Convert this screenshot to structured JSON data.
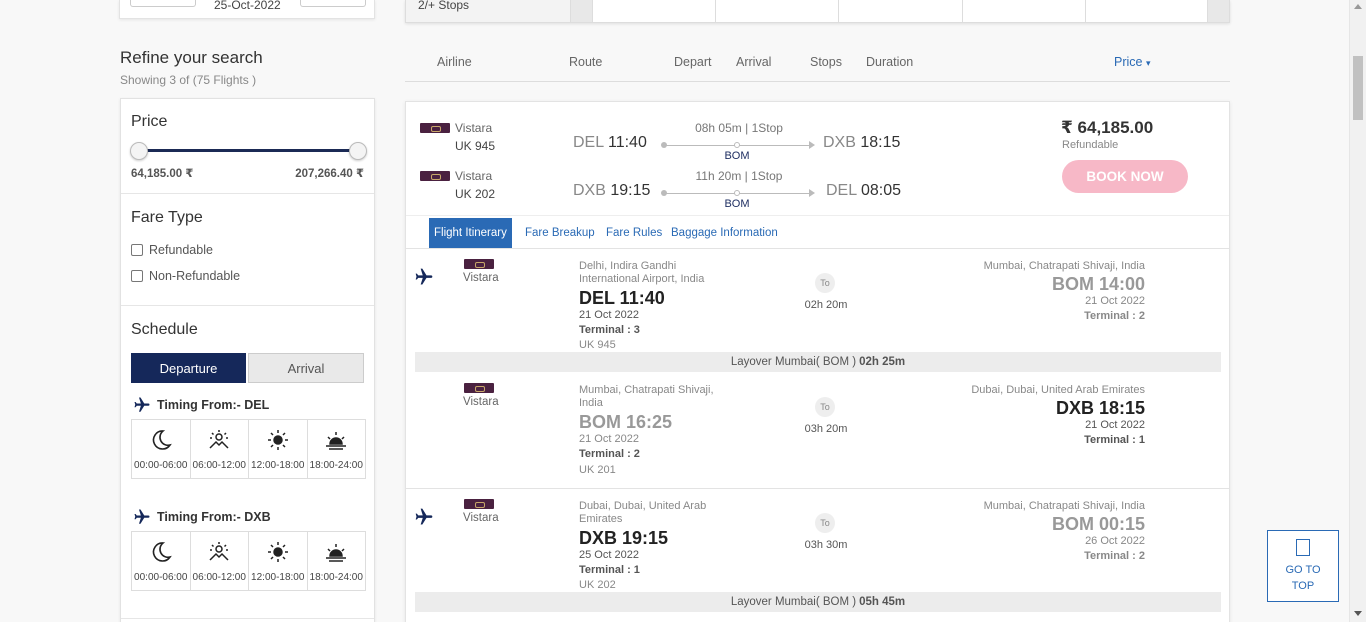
{
  "search_top": {
    "date": "25-Oct-2022",
    "stops_label": "2/+ Stops"
  },
  "refine": {
    "title": "Refine your search",
    "showing": "Showing 3 of (75 Flights )"
  },
  "filters": {
    "price": {
      "title": "Price",
      "min": "64,185.00 ₹",
      "max": "207,266.40 ₹"
    },
    "fare_type": {
      "title": "Fare Type",
      "options": [
        "Refundable",
        "Non-Refundable"
      ]
    },
    "schedule": {
      "title": "Schedule",
      "tabs": [
        "Departure",
        "Arrival"
      ],
      "active_tab": "Departure",
      "groups": [
        {
          "label": "Timing From:- DEL"
        },
        {
          "label": "Timing From:- DXB"
        }
      ],
      "slots": [
        "00:00-06:00",
        "06:00-12:00",
        "12:00-18:00",
        "18:00-24:00"
      ]
    }
  },
  "results_header": {
    "airline": "Airline",
    "route": "Route",
    "depart": "Depart",
    "arrival": "Arrival",
    "stops": "Stops",
    "duration": "Duration",
    "price": "Price"
  },
  "flight_card": {
    "outbound": {
      "airline": "Vistara",
      "code": "UK  945",
      "from_code": "DEL",
      "from_time": "11:40",
      "duration": "08h 05m | 1Stop",
      "via": "BOM",
      "to_code": "DXB",
      "to_time": "18:15"
    },
    "inbound": {
      "airline": "Vistara",
      "code": "UK  202",
      "from_code": "DXB",
      "from_time": "19:15",
      "duration": "11h 20m | 1Stop",
      "via": "BOM",
      "to_code": "DEL",
      "to_time": "08:05"
    },
    "price": "₹ 64,185.00",
    "refundable": "Refundable",
    "book": "BOOK NOW",
    "tabs": [
      "Flight Itinerary",
      "Fare Breakup",
      "Fare Rules",
      "Baggage Information"
    ],
    "itinerary": [
      {
        "airline": "Vistara",
        "from_place": "Delhi, Indira Gandhi International Airport, India",
        "from_big": "DEL 11:40",
        "from_date": "21 Oct 2022",
        "from_terminal": "Terminal : 3",
        "flight_no": "UK 945",
        "to_badge": "To",
        "duration": "02h 20m",
        "to_place": "Mumbai, Chatrapati Shivaji, India",
        "to_big": "BOM 14:00",
        "to_date": "21 Oct 2022",
        "to_terminal": "Terminal : 2"
      },
      {
        "airline": "Vistara",
        "from_place": "Mumbai, Chatrapati Shivaji, India",
        "from_big": "BOM 16:25",
        "from_date": "21 Oct 2022",
        "from_terminal": "Terminal : 2",
        "flight_no": "UK 201",
        "to_badge": "To",
        "duration": "03h 20m",
        "to_place": "Dubai, Dubai, United Arab Emirates",
        "to_big": "DXB 18:15",
        "to_date": "21 Oct 2022",
        "to_terminal": "Terminal : 1"
      },
      {
        "airline": "Vistara",
        "from_place": "Dubai, Dubai, United Arab Emirates",
        "from_big": "DXB 19:15",
        "from_date": "25 Oct 2022",
        "from_terminal": "Terminal : 1",
        "flight_no": "UK 202",
        "to_badge": "To",
        "duration": "03h 30m",
        "to_place": "Mumbai, Chatrapati Shivaji, India",
        "to_big": "BOM 00:15",
        "to_date": "26 Oct 2022",
        "to_terminal": "Terminal : 2"
      }
    ],
    "layovers": [
      {
        "label": "Layover Mumbai( BOM )",
        "time": "02h 25m"
      },
      {
        "label": "Layover Mumbai( BOM )",
        "time": "05h 45m"
      }
    ]
  },
  "go_to_top": {
    "line1": "GO TO",
    "line2": "TOP"
  },
  "colors": {
    "navy": "#15285a",
    "link": "#2a6ab5",
    "book_btn": "#f7b8c7",
    "vistara": "#4a2140"
  }
}
